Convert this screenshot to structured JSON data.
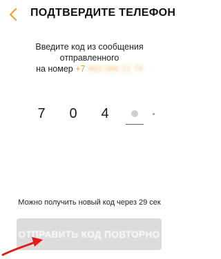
{
  "header": {
    "back_icon": "chevron-left-icon",
    "title": "ПОДТВЕРДИТЕ ТЕЛЕФОН"
  },
  "message": {
    "line1": "Введите код из сообщения",
    "line2": "отправленного",
    "line3_prefix": "на номер",
    "phone_code": "+7",
    "phone_hidden": "963 086 21 79"
  },
  "code": {
    "digits": [
      "7",
      "0",
      "4",
      ""
    ]
  },
  "resend": {
    "hint": "Можно получить новый код через 29 сек",
    "button_label": "ОТПРАВИТЬ КОД ПОВТОРНО"
  },
  "colors": {
    "accent": "#f0a030",
    "button_disabled": "#dcdcdc",
    "annotation": "#e11a1a"
  }
}
